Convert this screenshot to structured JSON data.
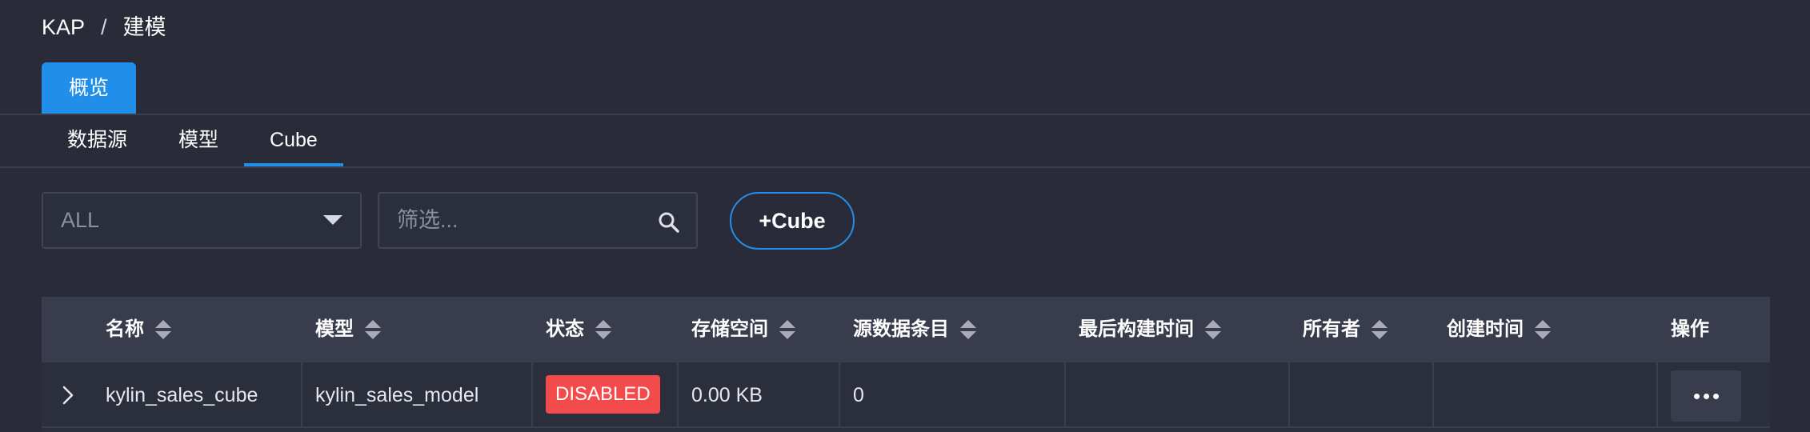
{
  "breadcrumb": {
    "root": "KAP",
    "separator": "/",
    "current": "建模"
  },
  "top_tab": {
    "label": "概览"
  },
  "sub_tabs": [
    {
      "label": "数据源",
      "active": false
    },
    {
      "label": "模型",
      "active": false
    },
    {
      "label": "Cube",
      "active": true
    }
  ],
  "filter": {
    "select_value": "ALL",
    "search_placeholder": "筛选...",
    "search_value": ""
  },
  "add_button": {
    "label": "+Cube"
  },
  "table": {
    "columns": [
      "名称",
      "模型",
      "状态",
      "存储空间",
      "源数据条目",
      "最后构建时间",
      "所有者",
      "创建时间",
      "操作"
    ],
    "rows": [
      {
        "name": "kylin_sales_cube",
        "model": "kylin_sales_model",
        "status": "DISABLED",
        "storage": "0.00 KB",
        "source_records": "0",
        "last_build_time": "",
        "owner": "",
        "create_time": ""
      }
    ]
  },
  "colors": {
    "accent": "#218fea",
    "background": "#292b38",
    "header_bg": "#393c4c",
    "status_disabled": "#f34b4b"
  },
  "icons": {
    "search": "search-icon",
    "caret": "caret-down-icon",
    "expand": "chevron-right-icon",
    "sort": "sort-icon",
    "more": "more-icon"
  }
}
